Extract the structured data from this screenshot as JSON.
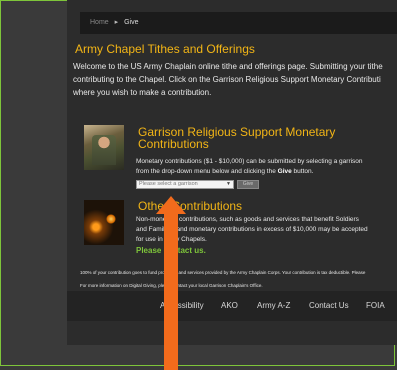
{
  "breadcrumb": {
    "home": "Home",
    "separator": "▸",
    "current": "Give"
  },
  "title": "Army Chapel Tithes and Offerings",
  "intro": [
    "Welcome to the US Army Chaplain online tithe and offerings page. Submitting your tithe",
    "contributing to the Chapel. Click on the Garrison Religious Support Monetary Contributi",
    "where you wish to make a contribution."
  ],
  "monetary": {
    "title": "Garrison Religious Support Monetary Contributions",
    "text_line1": "Monetary contributions ($1 - $10,000) can be submitted by selecting a garrison",
    "text_line2_pre": "from the drop-down menu below and clicking the ",
    "text_line2_bold": "Give",
    "text_line2_post": " button.",
    "select_placeholder": "Please select a garrison",
    "give_label": "Give"
  },
  "other": {
    "title": "Other Contributions",
    "lines": [
      "Non-monetary contributions, such as goods and services that benefit Soldiers",
      "and Families, and monetary contributions in excess of $10,000 may be accepted",
      "for use in Army Chapels."
    ],
    "contact": "Please contact us."
  },
  "footnotes": [
    "100% of your contribution goes to fund programs and services provided by the Army Chaplain Corps. Your contribution is tax deductible. Please",
    "For more information on Digital Giving, please contact your local Garrison Chaplain's Office."
  ],
  "footer": {
    "links": [
      "Accessibility",
      "AKO",
      "Army A-Z",
      "Contact Us",
      "FOIA"
    ]
  },
  "colors": {
    "accent": "#f2b516",
    "link_green": "#7ec53a",
    "arrow": "#f26b1c"
  }
}
